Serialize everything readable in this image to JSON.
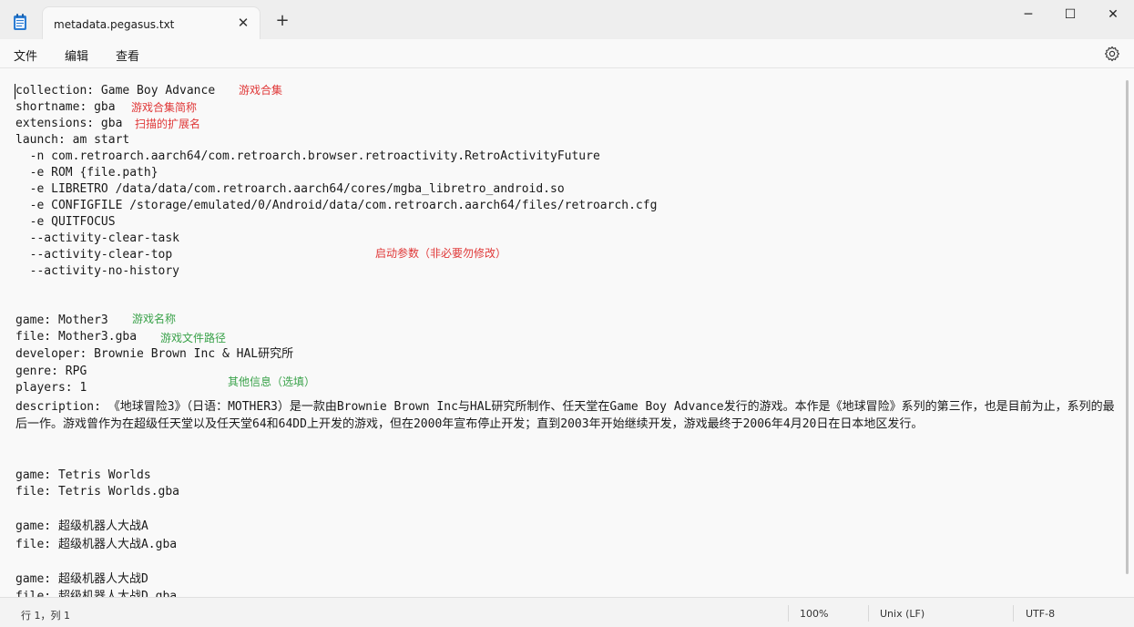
{
  "window": {
    "tab_title": "metadata.pegasus.txt",
    "new_tab_glyph": "+",
    "close_tab_glyph": "✕",
    "minimize_glyph": "─",
    "maximize_glyph": "☐",
    "close_glyph": "✕"
  },
  "menu": {
    "file": "文件",
    "edit": "编辑",
    "view": "查看"
  },
  "icons": {
    "app": "notepad-icon",
    "settings": "gear-icon"
  },
  "editor": {
    "lines": [
      "collection: Game Boy Advance",
      "shortname: gba",
      "extensions: gba",
      "launch: am start",
      "  -n com.retroarch.aarch64/com.retroarch.browser.retroactivity.RetroActivityFuture",
      "  -e ROM {file.path}",
      "  -e LIBRETRO /data/data/com.retroarch.aarch64/cores/mgba_libretro_android.so",
      "  -e CONFIGFILE /storage/emulated/0/Android/data/com.retroarch.aarch64/files/retroarch.cfg",
      "  -e QUITFOCUS",
      "  --activity-clear-task",
      "  --activity-clear-top",
      "  --activity-no-history",
      "game: Mother3",
      "file: Mother3.gba",
      "developer: Brownie Brown Inc & HAL研究所",
      "genre: RPG",
      "players: 1",
      "game: Tetris Worlds",
      "file: Tetris Worlds.gba",
      "game: 超级机器人大战A",
      "file: 超级机器人大战A.gba",
      "game: 超级机器人大战D",
      "file: 超级机器人大战D.gba"
    ],
    "description": "description: 《地球冒险3》（日语：MOTHER3）是一款由Brownie Brown Inc与HAL研究所制作、任天堂在Game Boy Advance发行的游戏。本作是《地球冒险》系列的第三作，也是目前为止，系列的最后一作。游戏曾作为在超级任天堂以及任天堂64和64DD上开发的游戏，但在2000年宣布停止开发；直到2003年开始继续开发，游戏最终于2006年4月20日在日本地区发行。",
    "annotations": {
      "collection": "游戏合集",
      "shortname": "游戏合集简称",
      "extensions": "扫描的扩展名",
      "launch": "启动参数（非必要勿修改）",
      "game": "游戏名称",
      "file": "游戏文件路径",
      "other": "其他信息（选填）"
    },
    "annotation_colors": {
      "red": "#e03838",
      "green": "#3aa24a"
    }
  },
  "status": {
    "position": "行 1，列 1",
    "zoom": "100%",
    "line_ending": "Unix (LF)",
    "encoding": "UTF-8"
  }
}
